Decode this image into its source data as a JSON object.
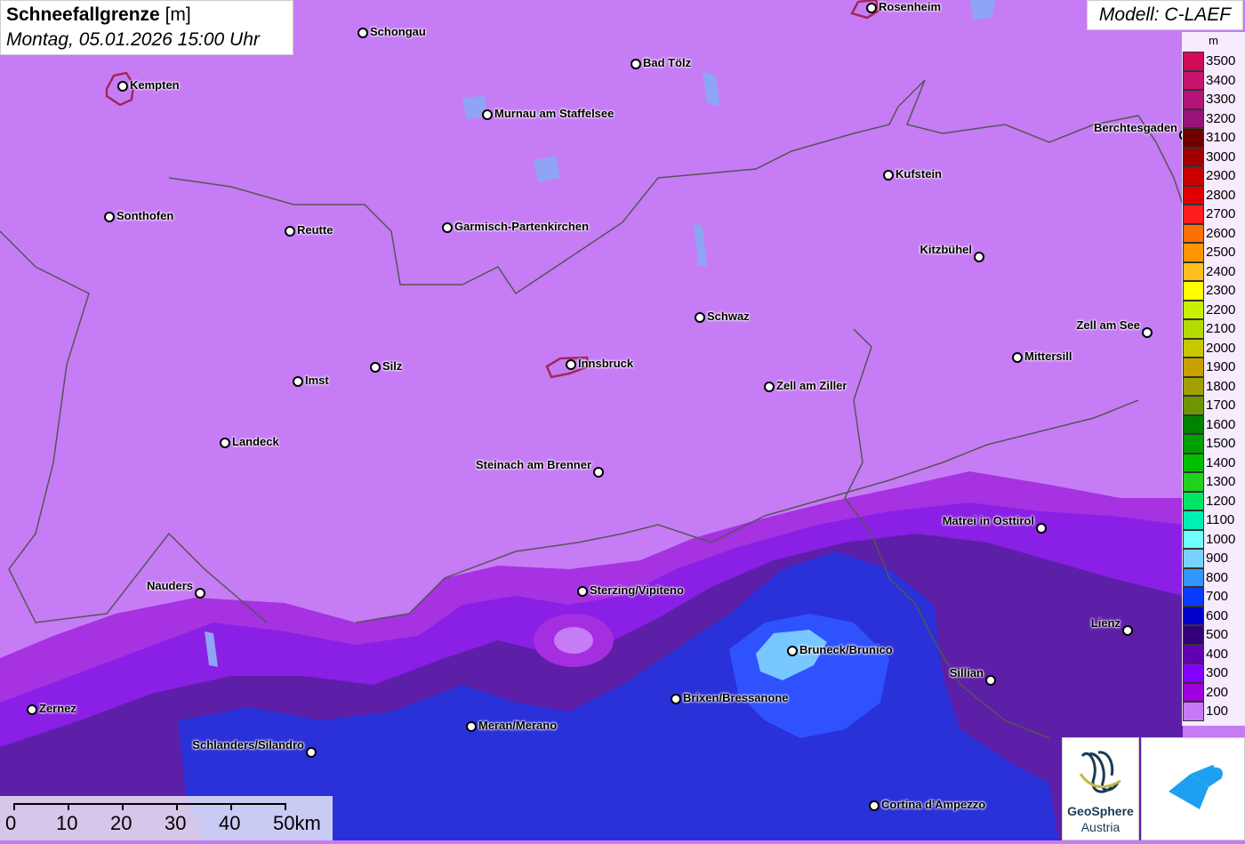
{
  "title": {
    "main": "Schneefallgrenze",
    "unit": "[m]",
    "date": "Montag, 05.01.2026 15:00 Uhr"
  },
  "model": "Modell: C-LAEF",
  "legend": {
    "unit": "m",
    "items": [
      {
        "label": "3500",
        "color": "#d20a5a"
      },
      {
        "label": "3400",
        "color": "#c8146e"
      },
      {
        "label": "3300",
        "color": "#b41478"
      },
      {
        "label": "3200",
        "color": "#961478"
      },
      {
        "label": "3100",
        "color": "#6e0000"
      },
      {
        "label": "3000",
        "color": "#a00000"
      },
      {
        "label": "2900",
        "color": "#c80000"
      },
      {
        "label": "2800",
        "color": "#e10000"
      },
      {
        "label": "2700",
        "color": "#ff1e1e"
      },
      {
        "label": "2600",
        "color": "#ff6e00"
      },
      {
        "label": "2500",
        "color": "#ff9600"
      },
      {
        "label": "2400",
        "color": "#ffbe1e"
      },
      {
        "label": "2300",
        "color": "#ffff00"
      },
      {
        "label": "2200",
        "color": "#c8f000"
      },
      {
        "label": "2100",
        "color": "#b4dc00"
      },
      {
        "label": "2000",
        "color": "#c8c800"
      },
      {
        "label": "1900",
        "color": "#c8a000"
      },
      {
        "label": "1800",
        "color": "#a0a000"
      },
      {
        "label": "1700",
        "color": "#6e9600"
      },
      {
        "label": "1600",
        "color": "#008200"
      },
      {
        "label": "1500",
        "color": "#00a000"
      },
      {
        "label": "1400",
        "color": "#00be00"
      },
      {
        "label": "1300",
        "color": "#1ed21e"
      },
      {
        "label": "1200",
        "color": "#00e664"
      },
      {
        "label": "1100",
        "color": "#00f0b4"
      },
      {
        "label": "1000",
        "color": "#6effff"
      },
      {
        "label": "900",
        "color": "#78d2ff"
      },
      {
        "label": "800",
        "color": "#3296ff"
      },
      {
        "label": "700",
        "color": "#0a3cff"
      },
      {
        "label": "600",
        "color": "#0000c8"
      },
      {
        "label": "500",
        "color": "#320078"
      },
      {
        "label": "400",
        "color": "#6400b4"
      },
      {
        "label": "300",
        "color": "#8200ff"
      },
      {
        "label": "200",
        "color": "#a000dc"
      },
      {
        "label": "100",
        "color": "#c678f5"
      }
    ]
  },
  "cities": [
    {
      "name": "Rosenheim",
      "side": "right"
    },
    {
      "name": "Schongau",
      "side": "right"
    },
    {
      "name": "Bad Tölz",
      "side": "right"
    },
    {
      "name": "Kempten",
      "side": "right"
    },
    {
      "name": "Murnau am Staffelsee",
      "side": "right"
    },
    {
      "name": "Berchtesgaden",
      "side": "left"
    },
    {
      "name": "Kufstein",
      "side": "right"
    },
    {
      "name": "Sonthofen",
      "side": "right"
    },
    {
      "name": "Reutte",
      "side": "right"
    },
    {
      "name": "Garmisch-Partenkirchen",
      "side": "right"
    },
    {
      "name": "Kitzbühel",
      "side": "left"
    },
    {
      "name": "Schwaz",
      "side": "right"
    },
    {
      "name": "Zell am See",
      "side": "left"
    },
    {
      "name": "Mittersill",
      "side": "right"
    },
    {
      "name": "Innsbruck",
      "side": "right"
    },
    {
      "name": "Silz",
      "side": "right"
    },
    {
      "name": "Imst",
      "side": "right"
    },
    {
      "name": "Zell am Ziller",
      "side": "right"
    },
    {
      "name": "Landeck",
      "side": "right"
    },
    {
      "name": "Steinach am Brenner",
      "side": "left"
    },
    {
      "name": "Matrei in Osttirol",
      "side": "left"
    },
    {
      "name": "Nauders",
      "side": "left"
    },
    {
      "name": "Sterzing/Vipiteno",
      "side": "right"
    },
    {
      "name": "Lienz",
      "side": "left"
    },
    {
      "name": "Bruneck/Brunico",
      "side": "right"
    },
    {
      "name": "Sillian",
      "side": "left"
    },
    {
      "name": "Zernez",
      "side": "right"
    },
    {
      "name": "Brixen/Bressanone",
      "side": "right"
    },
    {
      "name": "Meran/Merano",
      "side": "right"
    },
    {
      "name": "Schlanders/Silandro",
      "side": "left"
    },
    {
      "name": "Cortina d'Ampezzo",
      "side": "right"
    }
  ],
  "scale": {
    "labels": [
      "0",
      "10",
      "20",
      "30",
      "40",
      "50km"
    ]
  },
  "logos": {
    "geosphere_name": "GeoSphere",
    "geosphere_sub": "Austria"
  }
}
